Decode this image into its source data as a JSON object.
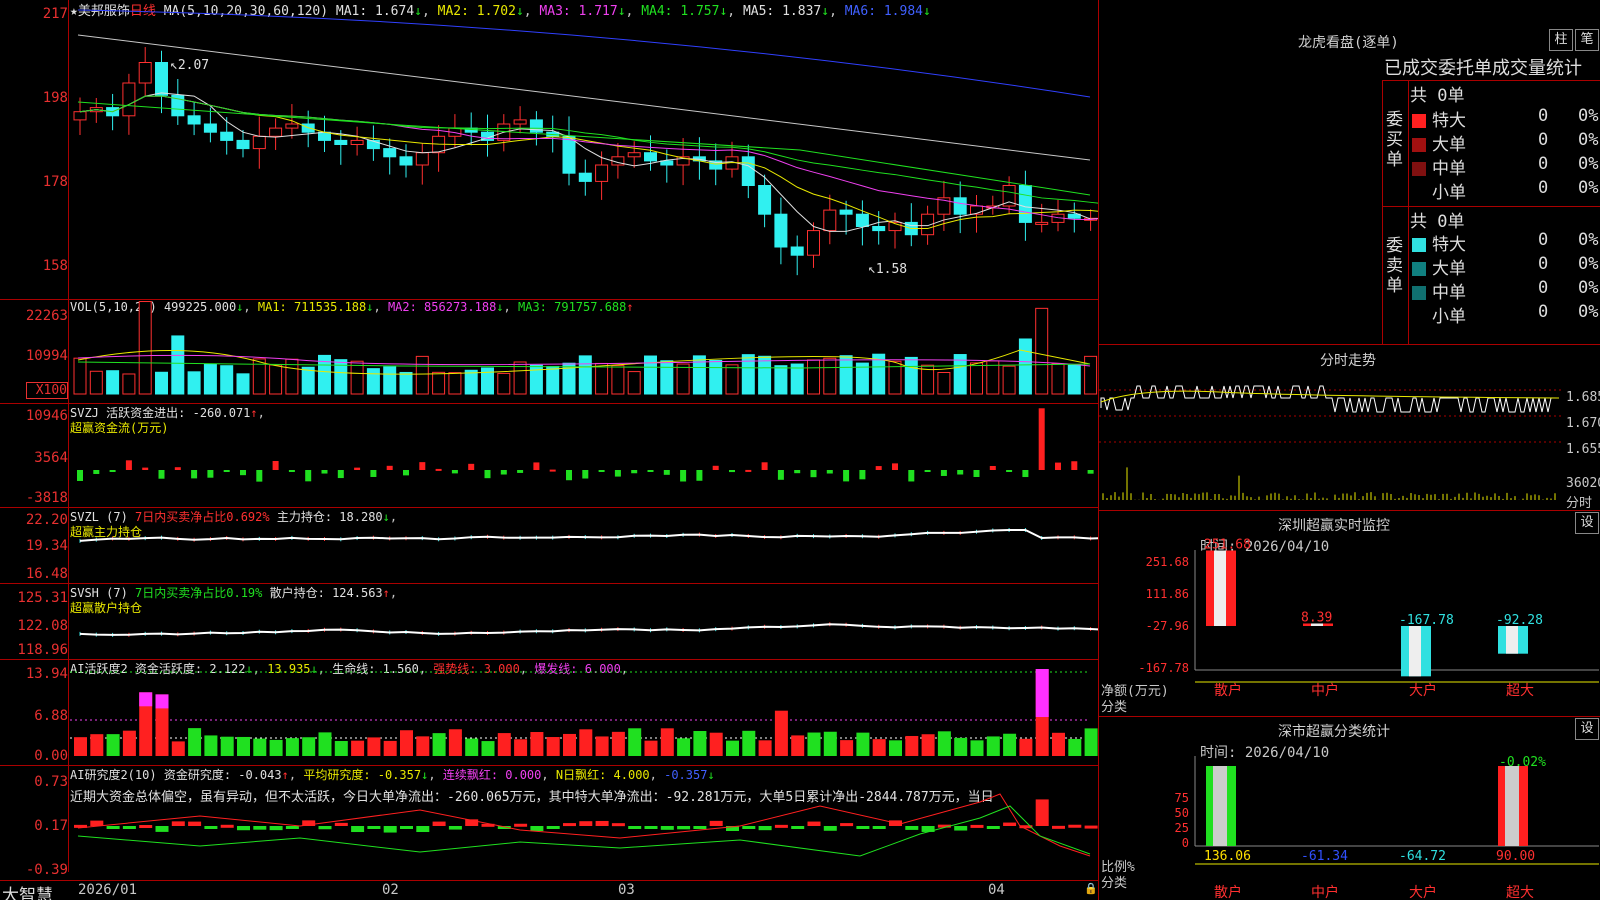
{
  "stock": {
    "name": "美邦服饰",
    "period": "日线",
    "star": "★"
  },
  "main": {
    "ma_label": "MA(5,10,20,30,60,120)",
    "ma1": "MA1: 1.674",
    "ma2": "MA2: 1.702",
    "ma3": "MA3: 1.717",
    "ma4": "MA4: 1.757",
    "ma5": "MA5: 1.837",
    "ma6": "MA6: 1.984",
    "y": [
      "217",
      "198",
      "178",
      "158"
    ],
    "hi": "2.07",
    "lo": "1.58"
  },
  "vol": {
    "label": "VOL(5,10,20)",
    "v": "499225.000",
    "ma1": "MA1: 711535.188",
    "ma2": "MA2: 856273.188",
    "ma3": "MA3: 791757.688",
    "y": [
      "22263",
      "10994"
    ],
    "unit": "X100"
  },
  "svzj": {
    "label": "SVZJ",
    "t1": "活跃资金进出: -260.071",
    "t2": "超赢资金流(万元)",
    "y": [
      "10946",
      "3564",
      "-3818"
    ]
  },
  "svzl": {
    "label": "SVZL (7)",
    "t1": "7日内买卖净占比0.692%",
    "t2": "主力持仓: 18.280",
    "t3": "超赢主力持仓",
    "y": [
      "22.20",
      "19.34",
      "16.48"
    ]
  },
  "svsh": {
    "label": "SVSH (7)",
    "t1": "7日内买卖净占比0.19%",
    "t2": "散户持仓: 124.563",
    "t3": "超赢散户持仓",
    "y": [
      "125.31",
      "122.08",
      "118.96"
    ]
  },
  "ai1": {
    "label": "AI活跃度2",
    "t1": "资金活跃度: 2.122",
    "t2": "13.935",
    "t3": "生命线: 1.560",
    "t4": "强势线: 3.000",
    "t5": "爆发线: 6.000",
    "y": [
      "13.94",
      "6.88",
      "0.00"
    ]
  },
  "ai2": {
    "label": "AI研究度2(10)",
    "t1": "资金研究度: -0.043",
    "t2": "平均研究度: -0.357",
    "t3": "连续飘红: 0.000",
    "t4": "N日飘红: 4.000",
    "t5": "-0.357",
    "text": "近期大资金总体偏空，虽有异动，但不太活跃，今日大单净流出：-260.065万元，其中特大单净流出：-92.281万元，大单5日累计净出-2844.787万元，当日",
    "y": [
      "0.73",
      "0.17",
      "-0.39"
    ]
  },
  "dates": [
    "2026/01",
    "02",
    "03",
    "04"
  ],
  "brand": "大智慧",
  "right": {
    "title": "龙虎看盘(逐单)",
    "btn1": "柱",
    "btn2": "笔",
    "subtitle": "已成交委托单成交量统计",
    "buy": {
      "side": "委买单",
      "total": "共 0单",
      "rows": [
        {
          "n": "特大",
          "v": "0",
          "p": "0%",
          "c": "#ff2020"
        },
        {
          "n": "大单",
          "v": "0",
          "p": "0%",
          "c": "#a01010"
        },
        {
          "n": "中单",
          "v": "0",
          "p": "0%",
          "c": "#801010"
        },
        {
          "n": "小单",
          "v": "0",
          "p": "0%",
          "c": "#000"
        }
      ]
    },
    "sell": {
      "side": "委卖单",
      "total": "共 0单",
      "rows": [
        {
          "n": "特大",
          "v": "0",
          "p": "0%",
          "c": "#30e0e0"
        },
        {
          "n": "大单",
          "v": "0",
          "p": "0%",
          "c": "#108080"
        },
        {
          "n": "中单",
          "v": "0",
          "p": "0%",
          "c": "#107070"
        },
        {
          "n": "小单",
          "v": "0",
          "p": "0%",
          "c": "#000"
        }
      ]
    },
    "fs_title": "分时走势",
    "fs_y": [
      "1.685",
      "1.670",
      "1.655"
    ],
    "fs_vol": "36020",
    "fs_unit": "分时",
    "m1": {
      "title": "深圳超赢实时监控",
      "btn": "设",
      "time": "时间: 2026/04/10",
      "y": [
        "251.68",
        "111.86",
        "-27.96",
        "-167.78"
      ],
      "ylab": "净额(万元)",
      "xlab": "分类",
      "cats": [
        "散户",
        "中户",
        "大户",
        "超大"
      ],
      "vals": [
        "251.68",
        "8.39",
        "-167.78",
        "-92.28"
      ]
    },
    "m2": {
      "title": "深市超赢分类统计",
      "btn": "设",
      "time": "时间: 2026/04/10",
      "y": [
        "75",
        "50",
        "25",
        "0"
      ],
      "ylab": "比例%",
      "xlab": "分类",
      "cats": [
        "散户",
        "中户",
        "大户",
        "超大"
      ],
      "vals": [
        "136.06",
        "-61.34",
        "-64.72",
        "90.00"
      ],
      "top": "-0.02%"
    }
  }
}
